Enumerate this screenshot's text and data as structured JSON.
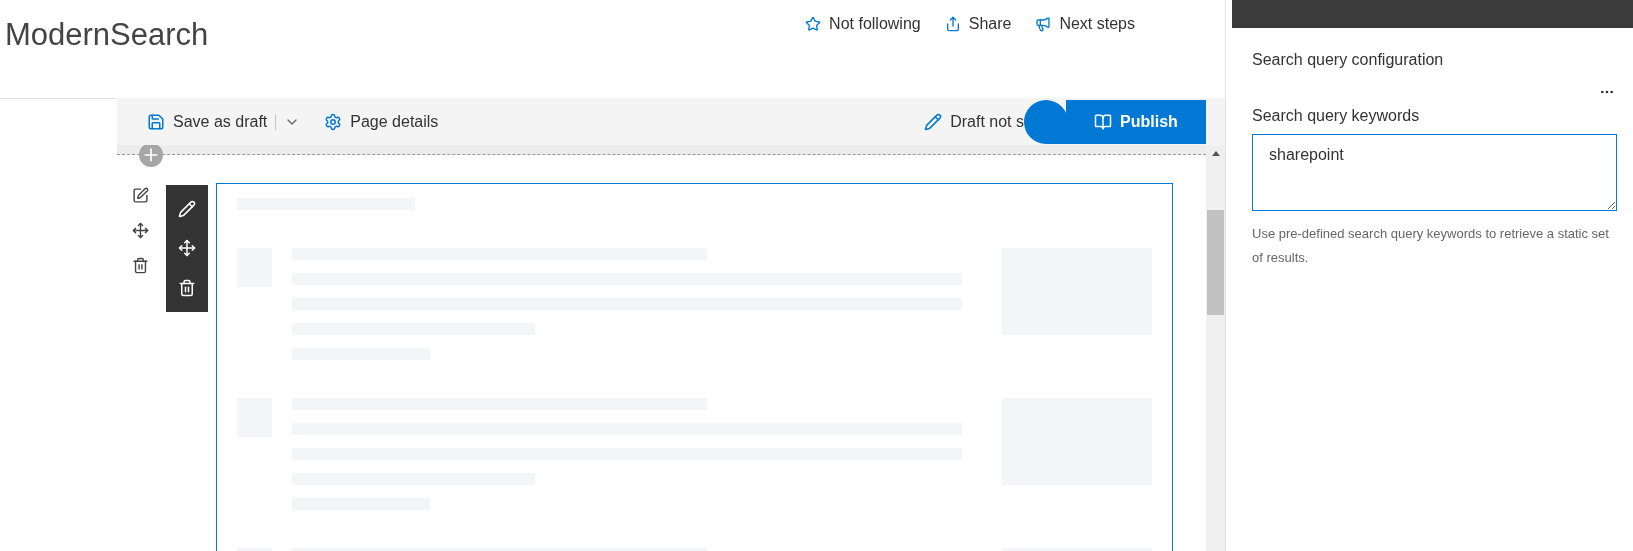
{
  "site": {
    "title": "ModernSearch"
  },
  "header_actions": [
    {
      "kind": "follow",
      "label": "Not following"
    },
    {
      "kind": "share",
      "label": "Share"
    },
    {
      "kind": "next",
      "label": "Next steps"
    }
  ],
  "command_bar": {
    "save": "Save as draft",
    "details": "Page details",
    "status": "Draft not s",
    "publish": "Publish"
  },
  "property_pane": {
    "section": "Search query configuration",
    "field_label": "Search query keywords",
    "field_value": "sharepoint",
    "description": "Use pre-defined search query keywords to retrieve a static set of results."
  }
}
